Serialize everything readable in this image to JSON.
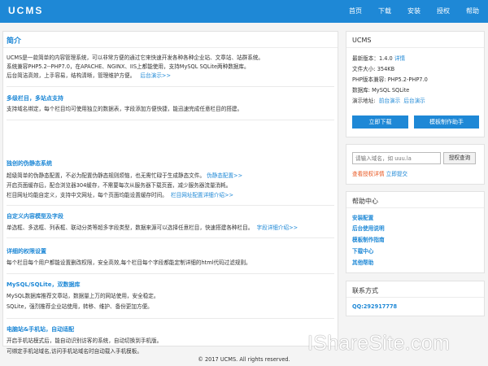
{
  "brand": {
    "logo": "UCMS"
  },
  "nav": [
    "首页",
    "下载",
    "安装",
    "授权",
    "帮助"
  ],
  "intro": {
    "title": "简介",
    "lines": [
      "UCMS是一款简单的内容管理系统，可以非常方便的通过它来快速开发各种各种企业站、文章站、站群系统。",
      "系统兼容PHP5.2--PHP7.0，在APACHE、NGINX、IIS上都能使用，支持MySQL SQLite两种数据库。",
      "后台简洁高效，上手容易，结构清晰，管理维护方便。"
    ],
    "demo_link": "后台演示>>"
  },
  "sections": [
    {
      "title": "多级栏目，多站点支持",
      "lines": [
        "支持域名绑定，每个栏目均可使用独立的数据表，字段添加方便快捷，能迅速完成任意栏目的搭建。"
      ],
      "link": ""
    },
    {
      "title": "独创的伪静态系统",
      "lines": [
        "超级简单的伪静态配置，不必为配置伪静态规则烦恼，也无需忙碌于生成静态文件。",
        "开启页面缓存后，配合浏览器304缓存，不需要每次从服务器下载页面，减少服务器流量消耗。",
        "栏目网址均能自定义，支持中文网址，每个页面均能设置缓存时间。"
      ],
      "links": [
        "伪静态配置>>",
        "栏目网址配置详细介绍>>"
      ]
    },
    {
      "title": "自定义内容模型及字段",
      "lines": [
        "单选框、多选框、列表框、联动分类等超多字段类型，数据来源可以选择任意栏目，快速搭建各种栏目。"
      ],
      "link": "字段详细介绍>>"
    },
    {
      "title": "详细的权限设置",
      "lines": [
        "每个栏目每个用户都能设置删改权限，安全高效,每个栏目每个字段都能定制详细的html代码过滤规则。"
      ],
      "link": ""
    },
    {
      "title": "MySQL/SQLite，双数据库",
      "lines": [
        "MySQL数据库推荐文章站，数据量上万的网站使用，安全稳定。",
        "SQLite，强烈推荐企业站使用，转移、维护、备份更加方便。"
      ],
      "link": ""
    },
    {
      "title": "电脑站&手机站，自动适配",
      "lines": [
        "开启手机站模式后，能自动识别访客的系统，自动切换到手机版。",
        "可绑定手机站域名,访问手机站域名时自动载入手机模板。"
      ],
      "link": ""
    }
  ],
  "sidebar": {
    "info": {
      "heading": "UCMS",
      "version_label": "最新版本：1.4.0",
      "version_link": "详情",
      "size": "文件大小: 354KB",
      "php": "PHP版本兼容: PHP5.2-PHP7.0",
      "db": "数据库: MySQL SQLite",
      "demo_label": "演示地址:",
      "front_demo": "前台演示",
      "back_demo": "后台演示",
      "download_btn": "立即下载",
      "template_btn": "模板制作助手"
    },
    "search": {
      "placeholder": "请输入域名，如 uuu.la",
      "button": "授权查询",
      "record_link": "查看授权详情",
      "submit_link": "立即提交"
    },
    "help": {
      "heading": "帮助中心",
      "items": [
        "安装配置",
        "后台使用说明",
        "模板制作指南",
        "下载中心",
        "其他帮助"
      ]
    },
    "contact": {
      "heading": "联系方式",
      "qq": "QQ:292917778"
    }
  },
  "footer": "© 2017 UCMS. All rights reserved.",
  "watermark": "IShareSite.com",
  "colors": {
    "accent": "#1e88d6",
    "warning": "#e8551f"
  }
}
